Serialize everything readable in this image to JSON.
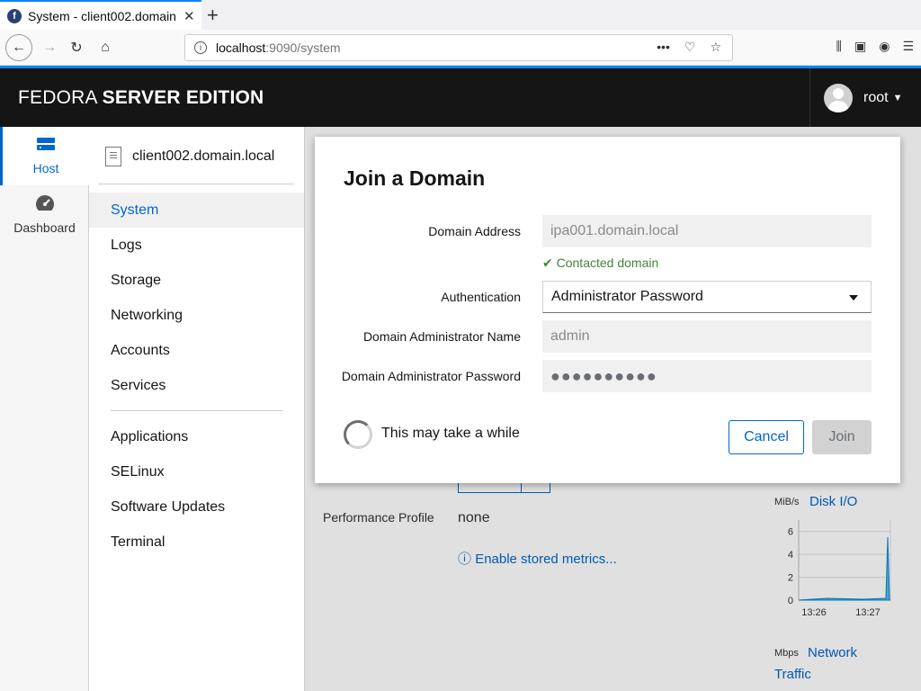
{
  "browser": {
    "tab_title": "System - client002.domain.local",
    "favicon": "f",
    "url_host": "localhost",
    "url_path": ":9090/system",
    "new_tab": "+",
    "close_tab": "✕"
  },
  "header": {
    "brand_light": "FEDORA",
    "brand_bold": "SERVER EDITION",
    "user": "root"
  },
  "leftnav": {
    "items": [
      {
        "label": "Host",
        "icon": "server-icon"
      },
      {
        "label": "Dashboard",
        "icon": "dashboard-icon"
      }
    ]
  },
  "menu": {
    "hostname": "client002.domain.local",
    "items": [
      "System",
      "Logs",
      "Storage",
      "Networking",
      "Accounts",
      "Services"
    ],
    "items2": [
      "Applications",
      "SELinux",
      "Software Updates",
      "Terminal"
    ]
  },
  "background": {
    "perf_label": "Performance Profile",
    "perf_value": "none",
    "metrics_link": "Enable stored metrics...",
    "disk_unit": "MiB/s",
    "disk_title": "Disk I/O",
    "net_unit": "Mbps",
    "net_title_1": "Network",
    "net_title_2": "Traffic"
  },
  "chart_data": {
    "type": "line",
    "title": "Disk I/O",
    "ylabel": "MiB/s",
    "yticks": [
      "6",
      "4",
      "2",
      "0"
    ],
    "xticks": [
      "13:26",
      "13:27"
    ],
    "ylim": [
      0,
      7
    ]
  },
  "modal": {
    "title": "Join a Domain",
    "domain_address_label": "Domain Address",
    "domain_address_value": "ipa001.domain.local",
    "contacted": "Contacted domain",
    "auth_label": "Authentication",
    "auth_value": "Administrator Password",
    "admin_name_label": "Domain Administrator Name",
    "admin_name_value": "admin",
    "admin_password_label": "Domain Administrator Password",
    "admin_password_value": "●●●●●●●●●●",
    "wait_text": "This may take a while",
    "cancel": "Cancel",
    "join": "Join"
  }
}
